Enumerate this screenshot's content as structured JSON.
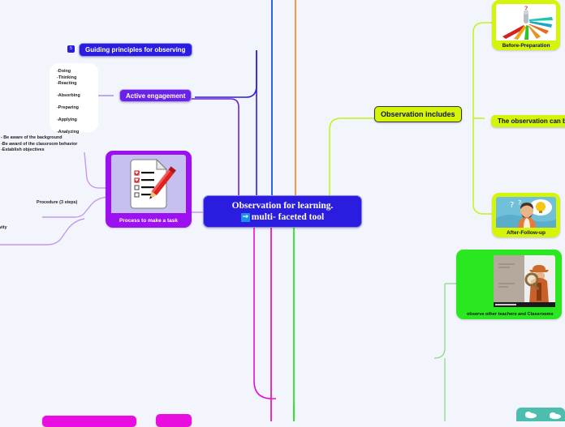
{
  "root": {
    "line1": "Observation for learning.",
    "line2": "multi- faceted tool",
    "arrow_icon": "→"
  },
  "branches": {
    "guiding": {
      "label": "Guiding principles for observing",
      "badge": "5"
    },
    "active_engagement": {
      "label": "Active engagement",
      "note": "-Doing\n-Thinking\n-Reacting\n\n-Absorbing\n\n-Preparing\n\n-Applying\n\n-Analyzing"
    },
    "principles_note": "- Be aware of the background\n-Be award of the classroom behavior\n-Establish objectives",
    "procedure_label": "Procedure (3 steps)",
    "activity_label": "tivity",
    "process_task": {
      "caption": "Process to make a task",
      "icon": "checklist-pencil-image"
    },
    "observation_includes": {
      "label": "Observation includes"
    },
    "observation_can_be": {
      "label": "The observation can b"
    },
    "before_preparation": {
      "caption": "Before-Preparation",
      "icon": "arrows-fan-figure-image"
    },
    "after_followup": {
      "caption": "After-Follow-up",
      "icon": "thinking-person-lightbulb-image"
    },
    "observe_other": {
      "caption": "observe other teachers and Classrooms",
      "icon": "detective-magnifier-image"
    }
  },
  "colors": {
    "background": "#f2f5fc",
    "root_fill": "#2a1de0",
    "lime": "#d4f409",
    "purple": "#6a22e8",
    "magenta": "#e80ee0",
    "green": "#2ae820",
    "teal": "#4dbdb0",
    "orange": "#f7821b",
    "blue_link": "#1157e8",
    "pink_link": "#f01ba6",
    "violet_link": "#c79ae8"
  }
}
